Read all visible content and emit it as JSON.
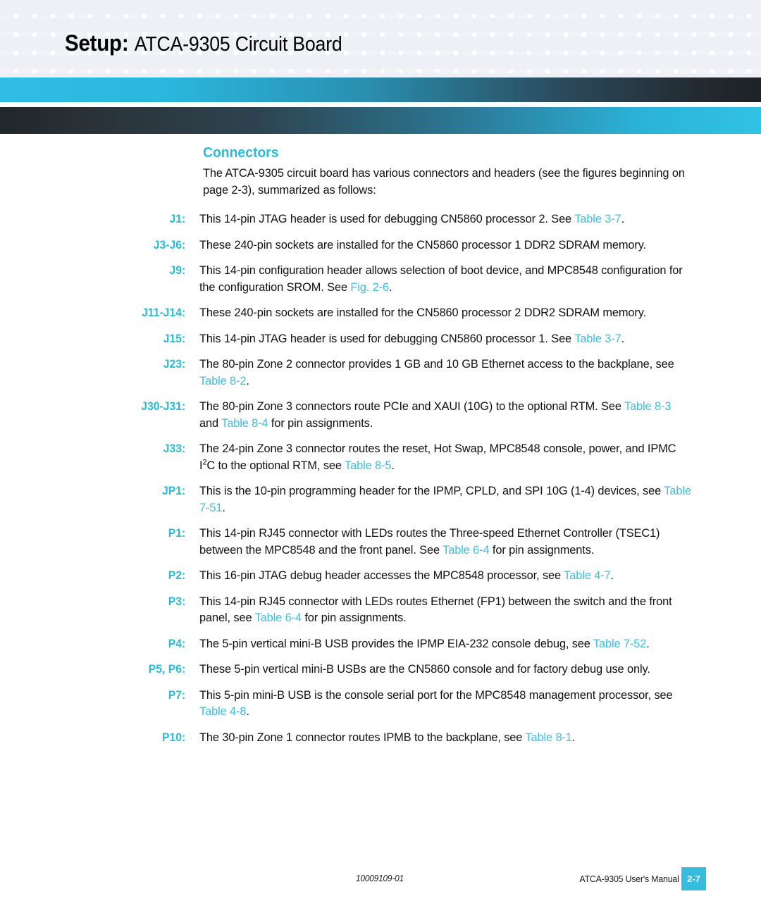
{
  "header": {
    "title_strong": "Setup:",
    "title_rest": "ATCA-9305 Circuit Board",
    "accent_cyan": "#2fbde3",
    "accent_dark": "#20272c"
  },
  "section": {
    "heading": "Connectors",
    "intro": "The ATCA-9305 circuit board has various connectors and headers (see the figures beginning on page 2-3), summarized as follows:"
  },
  "entries": [
    {
      "label": "J1:",
      "parts": [
        {
          "t": "This 14-pin JTAG header is used for debugging CN5860 processor 2. See ",
          "link": false
        },
        {
          "t": "Table 3-7",
          "link": true
        },
        {
          "t": ".",
          "link": false
        }
      ]
    },
    {
      "label": "J3-J6:",
      "parts": [
        {
          "t": "These 240-pin sockets are installed for the CN5860 processor 1 DDR2 SDRAM memory.",
          "link": false
        }
      ]
    },
    {
      "label": "J9:",
      "parts": [
        {
          "t": "This 14-pin configuration header allows selection of boot device, and MPC8548 configuration for the configuration SROM. See ",
          "link": false
        },
        {
          "t": "Fig. 2-6",
          "link": true
        },
        {
          "t": ".",
          "link": false
        }
      ]
    },
    {
      "label": "J11-J14:",
      "parts": [
        {
          "t": "These 240-pin sockets are installed for the CN5860 processor 2 DDR2 SDRAM memory.",
          "link": false
        }
      ]
    },
    {
      "label": "J15:",
      "parts": [
        {
          "t": "This 14-pin JTAG header is used for debugging CN5860 processor 1. See ",
          "link": false
        },
        {
          "t": "Table 3-7",
          "link": true
        },
        {
          "t": ".",
          "link": false
        }
      ]
    },
    {
      "label": "J23:",
      "parts": [
        {
          "t": "The 80-pin Zone 2 connector provides 1 GB and 10 GB Ethernet access to the backplane, see ",
          "link": false
        },
        {
          "t": "Table 8-2",
          "link": true
        },
        {
          "t": ".",
          "link": false
        }
      ]
    },
    {
      "label": "J30-J31:",
      "parts": [
        {
          "t": "The 80-pin Zone 3 connectors route PCIe and XAUI (10G) to the optional RTM. See ",
          "link": false
        },
        {
          "t": "Table 8-3",
          "link": true
        },
        {
          "t": " and ",
          "link": false
        },
        {
          "t": "Table 8-4",
          "link": true
        },
        {
          "t": " for pin assignments.",
          "link": false
        }
      ]
    },
    {
      "label": "J33:",
      "parts": [
        {
          "t": "The 24-pin Zone 3 connector routes the reset, Hot Swap, MPC8548 console, power, and IPMC I",
          "link": false
        },
        {
          "t": "2",
          "sup": true
        },
        {
          "t": "C to the optional RTM, see ",
          "link": false
        },
        {
          "t": "Table 8-5",
          "link": true
        },
        {
          "t": ".",
          "link": false
        }
      ]
    },
    {
      "label": "JP1:",
      "parts": [
        {
          "t": "This is the 10-pin programming header for the IPMP, CPLD, and SPI 10G (1-4) devices, see ",
          "link": false
        },
        {
          "t": "Table 7-51",
          "link": true
        },
        {
          "t": ".",
          "link": false
        }
      ]
    },
    {
      "label": "P1:",
      "parts": [
        {
          "t": "This 14-pin RJ45 connector with LEDs routes the Three-speed Ethernet Controller (TSEC1) between the MPC8548 and the front panel. See ",
          "link": false
        },
        {
          "t": "Table 6-4",
          "link": true
        },
        {
          "t": " for pin assignments.",
          "link": false
        }
      ]
    },
    {
      "label": "P2:",
      "parts": [
        {
          "t": "This 16-pin JTAG debug header accesses the MPC8548 processor, see ",
          "link": false
        },
        {
          "t": "Table 4-7",
          "link": true
        },
        {
          "t": ".",
          "link": false
        }
      ]
    },
    {
      "label": "P3:",
      "parts": [
        {
          "t": "This 14-pin RJ45 connector with LEDs routes Ethernet (FP1) between the switch and the front panel, see ",
          "link": false
        },
        {
          "t": "Table 6-4",
          "link": true
        },
        {
          "t": " for pin assignments.",
          "link": false
        }
      ]
    },
    {
      "label": "P4:",
      "parts": [
        {
          "t": "The 5-pin vertical mini-B USB provides the IPMP EIA-232 console debug, see ",
          "link": false
        },
        {
          "t": "Table 7-52",
          "link": true
        },
        {
          "t": ".",
          "link": false
        }
      ]
    },
    {
      "label": "P5, P6:",
      "parts": [
        {
          "t": "These 5-pin vertical mini-B USBs are the CN5860 console and for factory debug use only.",
          "link": false
        }
      ]
    },
    {
      "label": "P7:",
      "parts": [
        {
          "t": "This 5-pin mini-B USB is the console serial port for the MPC8548 management processor, see ",
          "link": false
        },
        {
          "t": "Table 4-8",
          "link": true
        },
        {
          "t": ".",
          "link": false
        }
      ]
    },
    {
      "label": "P10:",
      "parts": [
        {
          "t": "The 30-pin Zone 1 connector routes IPMB to the backplane, see ",
          "link": false
        },
        {
          "t": "Table 8-1",
          "link": true
        },
        {
          "t": ".",
          "link": false
        }
      ]
    }
  ],
  "footer": {
    "doc_number": "10009109-01",
    "manual_title": "ATCA-9305 User's Manual",
    "page_number": "2-7",
    "page_badge_color": "#36bcdc"
  }
}
